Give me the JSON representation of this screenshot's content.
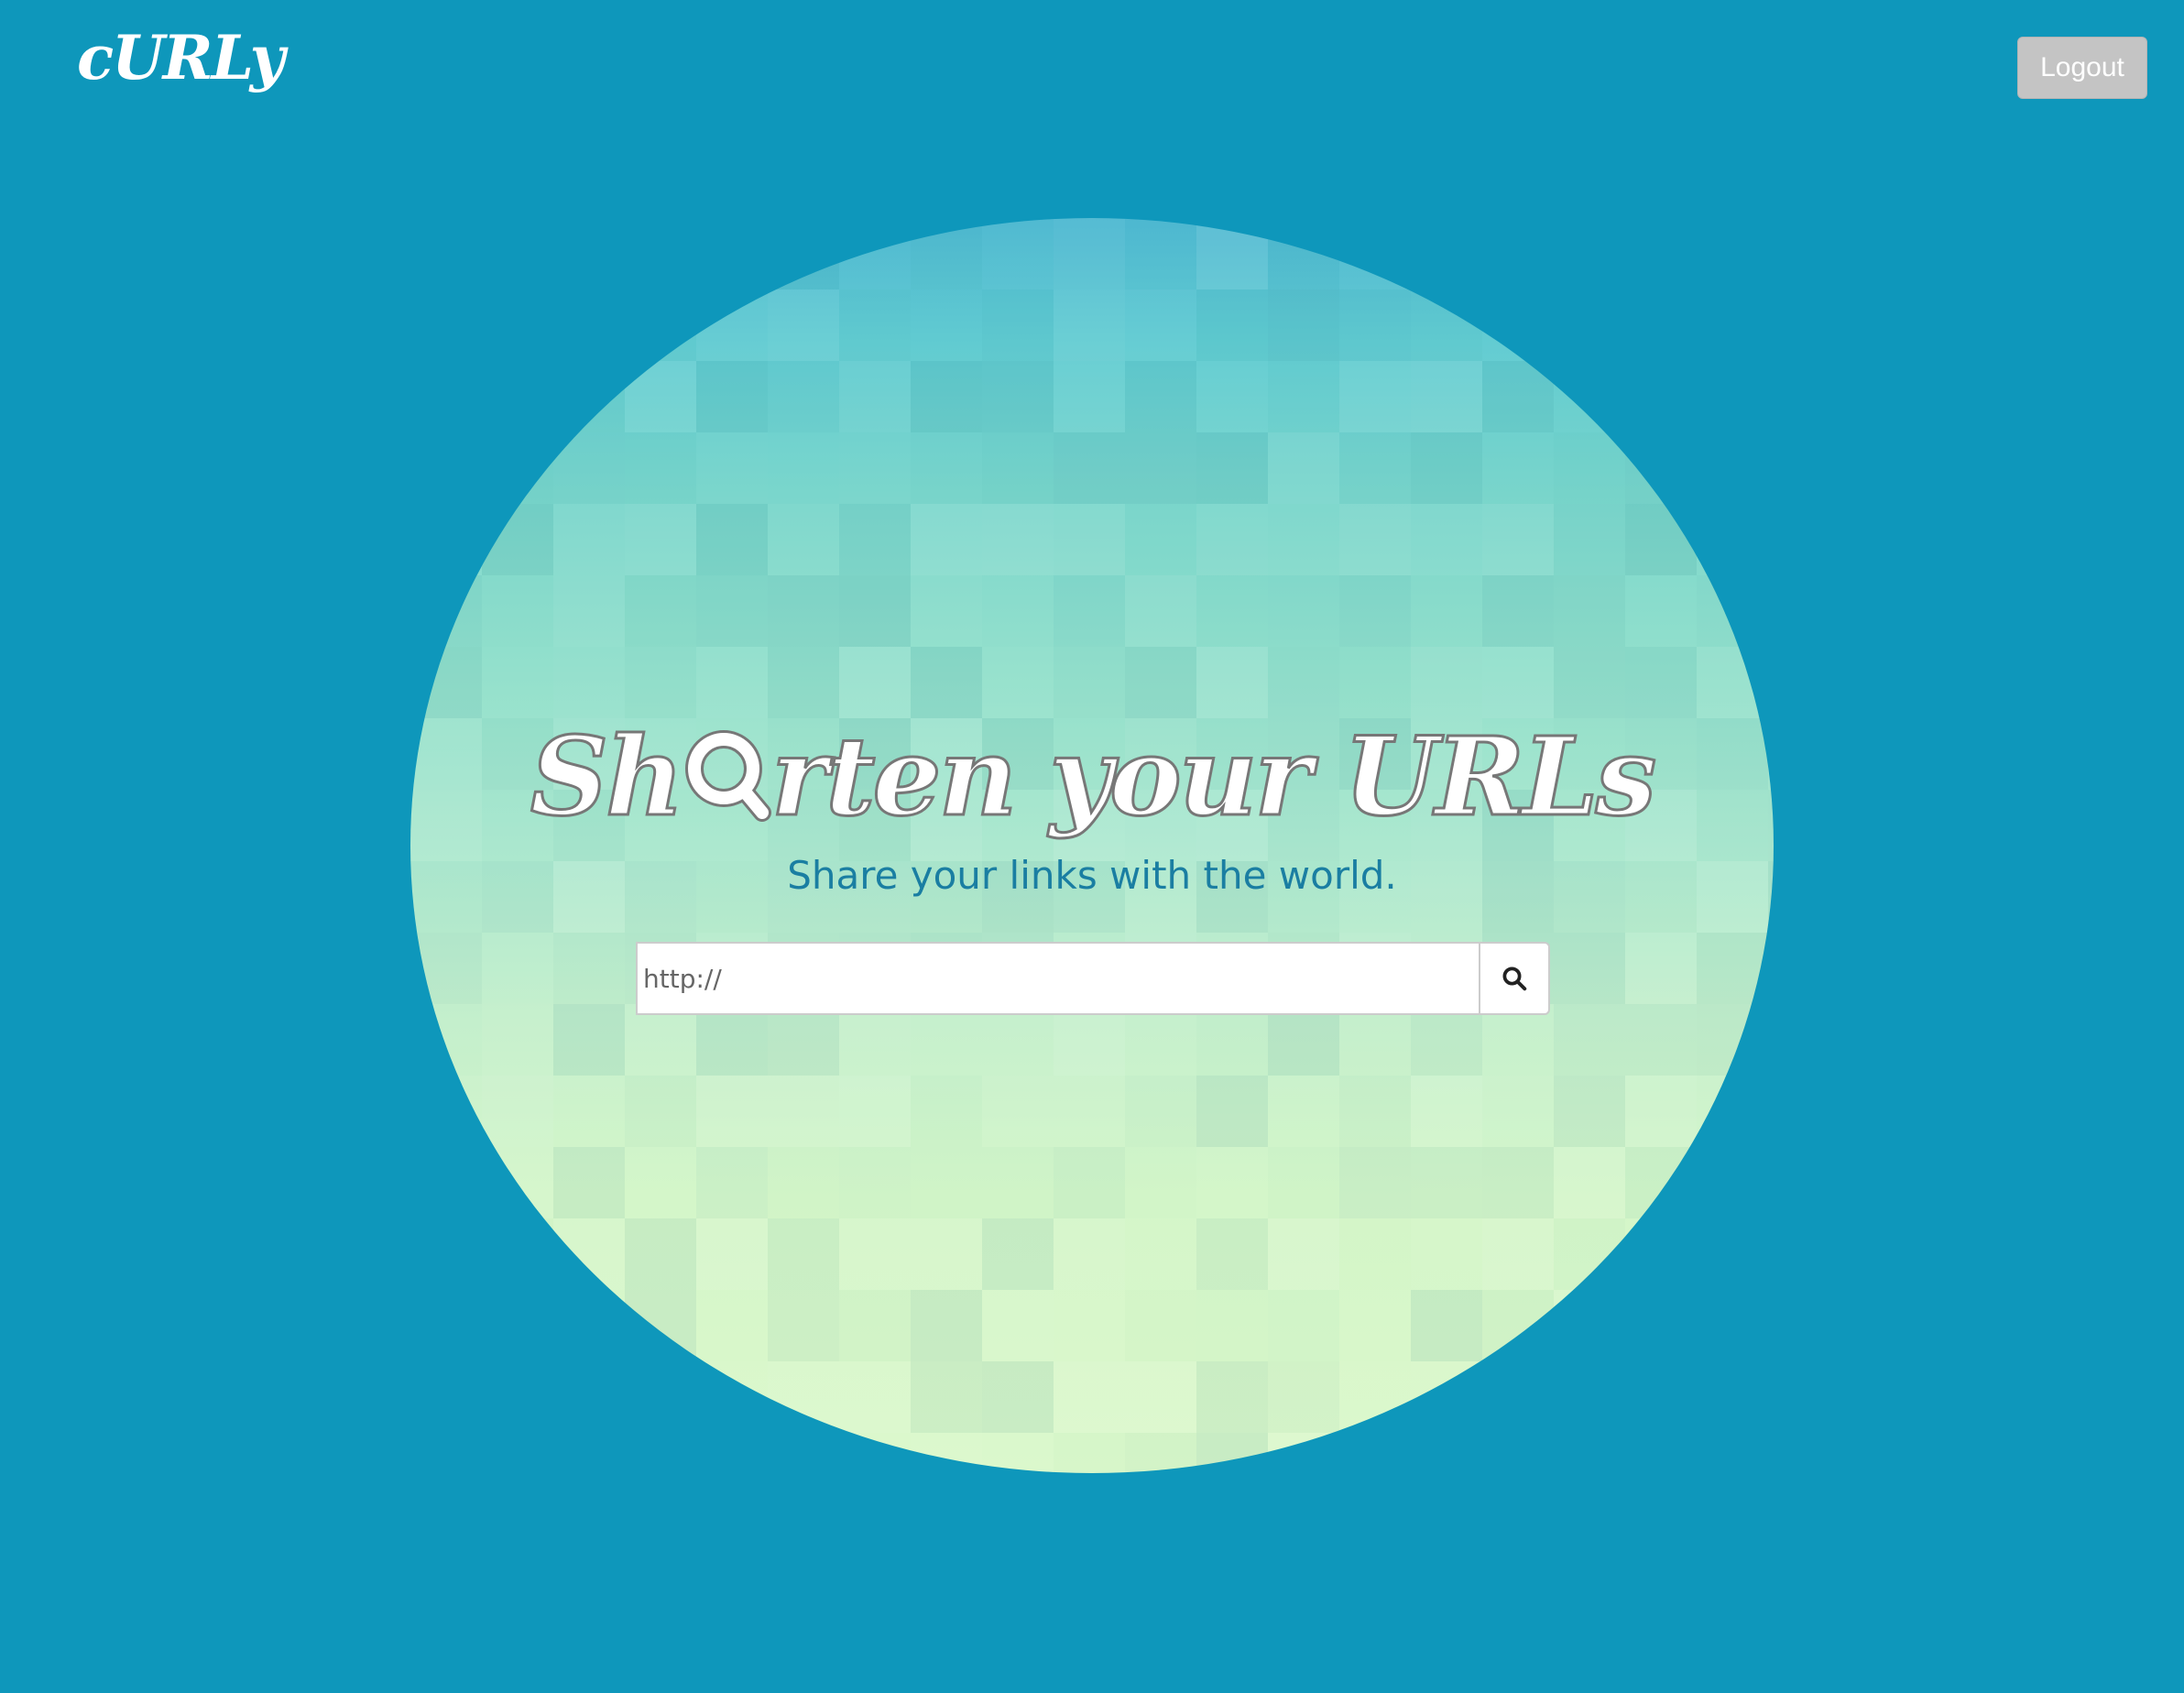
{
  "header": {
    "logo_text": "cURLy",
    "logout_label": "Logout"
  },
  "hero": {
    "title_before": "Sh",
    "title_after": "rten your URLs",
    "subtitle": "Share your links with the world.",
    "search": {
      "placeholder": "http://",
      "value": ""
    }
  },
  "icons": {
    "title_o": "magnifier-icon",
    "search_button": "search-icon"
  },
  "colors": {
    "page_background": "#0e97bb",
    "subtitle": "#1a7ea2",
    "logout_button": "#c4c4c4"
  }
}
